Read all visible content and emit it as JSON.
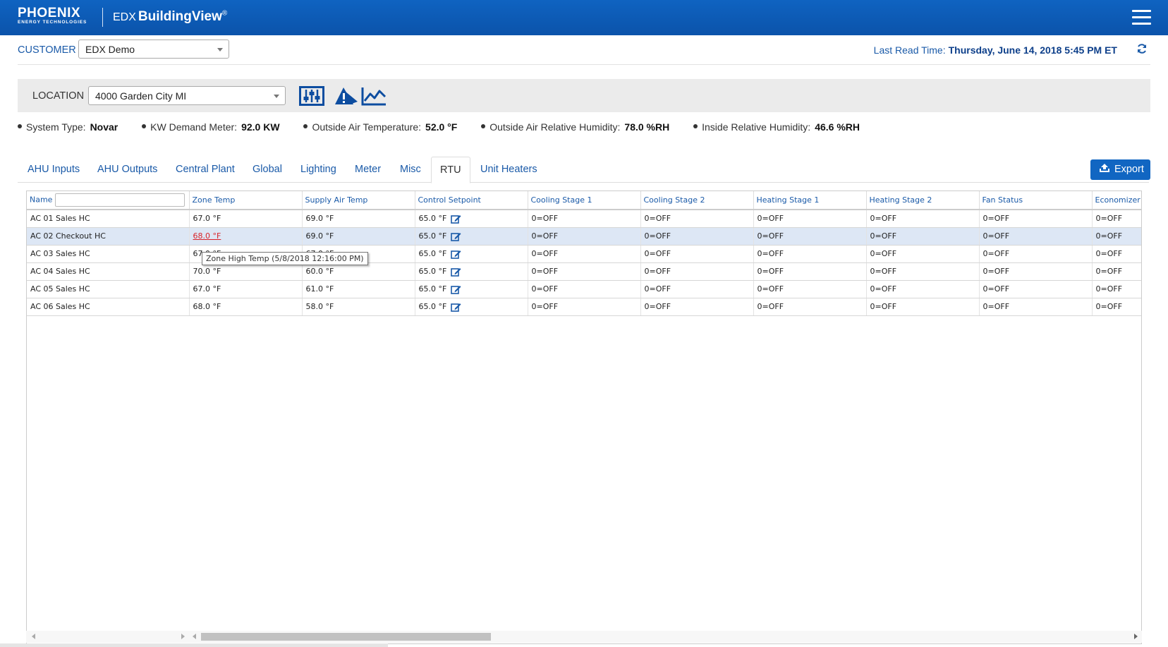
{
  "header": {
    "brand_name": "PHOENIX",
    "brand_sub": "ENERGY TECHNOLOGIES",
    "product_prefix": "EDX",
    "product_name": "BuildingView",
    "product_mark": "®"
  },
  "customer": {
    "label": "CUSTOMER",
    "value": "EDX Demo"
  },
  "last_read": {
    "label": "Last Read Time:",
    "value": "Thursday, June 14, 2018 5:45 PM ET"
  },
  "location": {
    "label": "LOCATION",
    "value": "4000 Garden City MI"
  },
  "status": [
    {
      "label": "System Type:",
      "value": "Novar"
    },
    {
      "label": "KW Demand Meter:",
      "value": "92.0 KW"
    },
    {
      "label": "Outside Air Temperature:",
      "value": "52.0 °F"
    },
    {
      "label": "Outside Air Relative Humidity:",
      "value": "78.0 %RH"
    },
    {
      "label": "Inside Relative Humidity:",
      "value": "46.6 %RH"
    }
  ],
  "tabs": [
    "AHU Inputs",
    "AHU Outputs",
    "Central Plant",
    "Global",
    "Lighting",
    "Meter",
    "Misc",
    "RTU",
    "Unit Heaters"
  ],
  "active_tab": "RTU",
  "export_label": "Export",
  "grid": {
    "columns": [
      "Name",
      "Zone Temp",
      "Supply Air Temp",
      "Control Setpoint",
      "Cooling Stage 1",
      "Cooling Stage 2",
      "Heating Stage 1",
      "Heating Stage 2",
      "Fan Status",
      "Economizer"
    ],
    "name_filter_value": "",
    "rows": [
      {
        "name": "AC 01 Sales HC",
        "zone": "67.0 °F",
        "supply": "69.0 °F",
        "setpoint": "65.0 °F",
        "c1": "0=OFF",
        "c2": "0=OFF",
        "h1": "0=OFF",
        "h2": "0=OFF",
        "fan": "0=OFF",
        "econ": "0=OFF"
      },
      {
        "name": "AC 02 Checkout HC",
        "zone": "68.0 °F",
        "supply": "69.0 °F",
        "setpoint": "65.0 °F",
        "c1": "0=OFF",
        "c2": "0=OFF",
        "h1": "0=OFF",
        "h2": "0=OFF",
        "fan": "0=OFF",
        "econ": "0=OFF"
      },
      {
        "name": "AC 03 Sales HC",
        "zone": "67.0 °F",
        "supply": "67.0 °F",
        "setpoint": "65.0 °F",
        "c1": "0=OFF",
        "c2": "0=OFF",
        "h1": "0=OFF",
        "h2": "0=OFF",
        "fan": "0=OFF",
        "econ": "0=OFF"
      },
      {
        "name": "AC 04 Sales HC",
        "zone": "70.0 °F",
        "supply": "60.0 °F",
        "setpoint": "65.0 °F",
        "c1": "0=OFF",
        "c2": "0=OFF",
        "h1": "0=OFF",
        "h2": "0=OFF",
        "fan": "0=OFF",
        "econ": "0=OFF"
      },
      {
        "name": "AC 05 Sales HC",
        "zone": "67.0 °F",
        "supply": "61.0 °F",
        "setpoint": "65.0 °F",
        "c1": "0=OFF",
        "c2": "0=OFF",
        "h1": "0=OFF",
        "h2": "0=OFF",
        "fan": "0=OFF",
        "econ": "0=OFF"
      },
      {
        "name": "AC 06 Sales HC",
        "zone": "68.0 °F",
        "supply": "58.0 °F",
        "setpoint": "65.0 °F",
        "c1": "0=OFF",
        "c2": "0=OFF",
        "h1": "0=OFF",
        "h2": "0=OFF",
        "fan": "0=OFF",
        "econ": "0=OFF"
      }
    ],
    "selected_row": 1,
    "alarm_cell": {
      "row": 1,
      "column": "Zone Temp"
    }
  },
  "tooltip": "Zone High Temp (5/8/2018 12:16:00 PM)",
  "colors": {
    "header_bg": "#0b58b4",
    "link_blue": "#1a5aa8",
    "alarm_red": "#d8232a",
    "selected_row": "#dde7f5",
    "button_blue": "#1166c2"
  },
  "icons": [
    "menu-icon",
    "refresh-icon",
    "controls-icon",
    "alarm-icon",
    "trend-chart-icon",
    "upload-icon",
    "edit-icon"
  ]
}
